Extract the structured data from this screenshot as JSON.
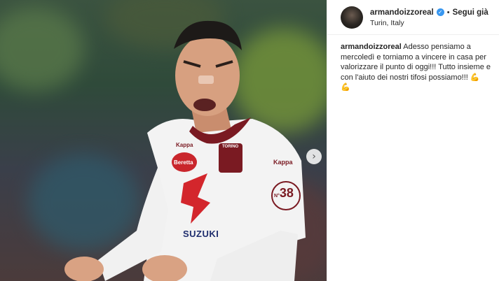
{
  "post": {
    "username": "armandoizzoreal",
    "follow_label": "Segui già",
    "separator": "•",
    "location": "Turin, Italy",
    "caption_text": "Adesso pensiamo a mercoledì e torniamo a vincere in casa per valorizzare il punto di oggi!!! Tutto insieme e con l'aiuto dei nostri tifosi possiamo!!!",
    "caption_emoji_1": "💪",
    "caption_emoji_2": "💪"
  },
  "photo": {
    "jersey_sponsor_top": "Kappa",
    "jersey_club": "TORINO",
    "jersey_brand_left": "Beretta",
    "jersey_sponsor_main": "SUZUKI",
    "jersey_number": "38",
    "jersey_number_prefix": "N°",
    "next_icon": "chevron-right-icon"
  },
  "colors": {
    "verified_blue": "#3897f0",
    "jersey_white": "#f3f3f3",
    "torino_maroon": "#7a1a22",
    "suzuki_red": "#d3262c"
  }
}
